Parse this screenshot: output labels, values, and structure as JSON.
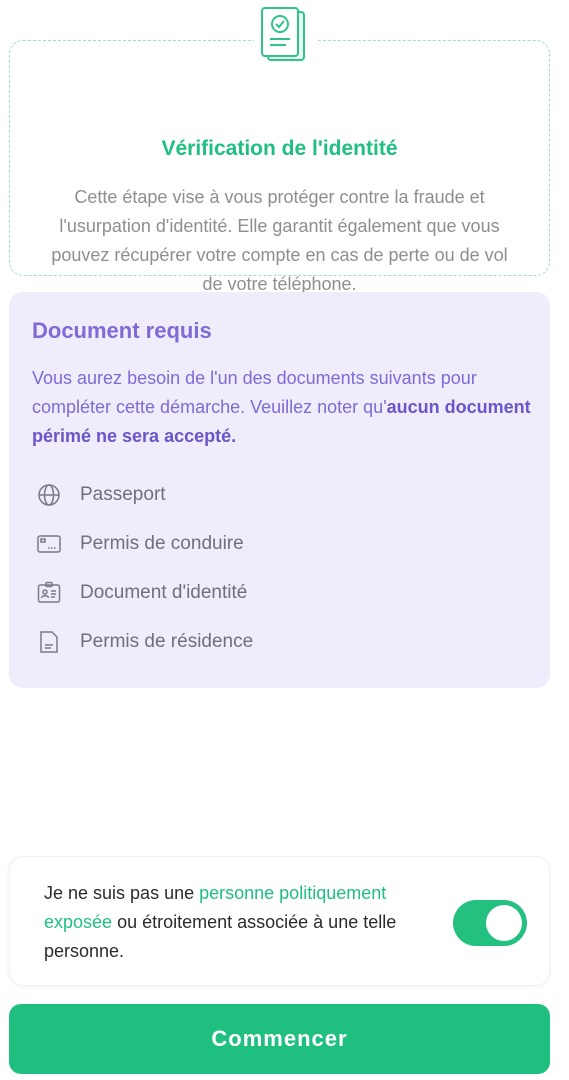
{
  "verification": {
    "title": "Vérification de l'identité",
    "description": "Cette étape vise à vous protéger contre la fraude et l'usurpation d'identité. Elle garantit également que vous pouvez récupérer votre compte en cas de perte ou de vol de votre téléphone."
  },
  "documents": {
    "title": "Document requis",
    "description_pre": "Vous aurez besoin de l'un des documents suivants pour compléter cette démarche. Veuillez noter qu'",
    "description_bold": "aucun document périmé ne sera accepté.",
    "items": [
      {
        "label": "Passeport",
        "icon": "globe-icon"
      },
      {
        "label": "Permis de conduire",
        "icon": "license-card-icon"
      },
      {
        "label": "Document d'identité",
        "icon": "id-badge-icon"
      },
      {
        "label": "Permis de résidence",
        "icon": "document-icon"
      }
    ]
  },
  "pep": {
    "text_pre": "Je ne suis pas une ",
    "text_link": "personne politiquement exposée",
    "text_post": " ou étroitement associée à une telle personne.",
    "toggle_on": true
  },
  "button": {
    "label": "Commencer"
  },
  "colors": {
    "accent_green": "#1fbf81",
    "purple_text": "#7e6bd6",
    "purple_bg": "#efecfb"
  }
}
